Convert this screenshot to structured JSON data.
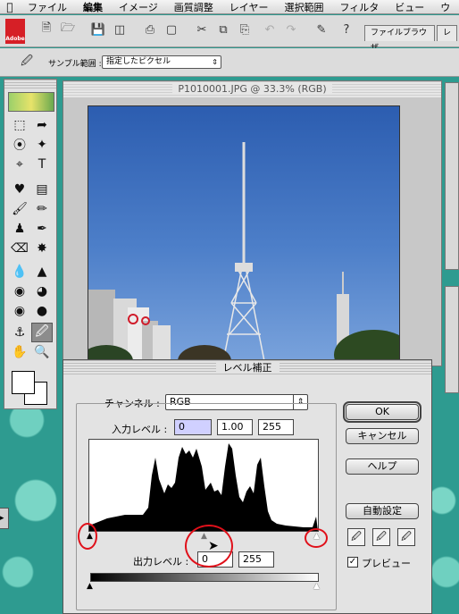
{
  "menubar": {
    "items": [
      "ファイル",
      "編集",
      "イメージ",
      "画質調整",
      "レイヤー",
      "選択範囲",
      "フィルタ",
      "ビュー",
      "ウ"
    ],
    "active_index": 1
  },
  "toolbar": {
    "tabs": [
      "ファイルブラウザ",
      "レ"
    ]
  },
  "options_bar": {
    "sample_label": "サンプル範囲 :",
    "sample_value": "指定したピクセル"
  },
  "document": {
    "title": "P1010001.JPG @ 33.3% (RGB)"
  },
  "dialog": {
    "title": "レベル補正",
    "channel_label": "チャンネル :",
    "channel_value": "RGB",
    "input_label": "入力レベル :",
    "input_black": "0",
    "input_gamma": "1.00",
    "input_white": "255",
    "output_label": "出力レベル :",
    "output_black": "0",
    "output_white": "255",
    "buttons": {
      "ok": "OK",
      "cancel": "キャンセル",
      "help": "ヘルプ",
      "auto": "自動設定"
    },
    "preview_label": "プレビュー",
    "preview_checked": true
  },
  "colors": {
    "desktop": "#2e9b90",
    "annotation_red": "#e0101a",
    "sky": "#2c5db0"
  }
}
